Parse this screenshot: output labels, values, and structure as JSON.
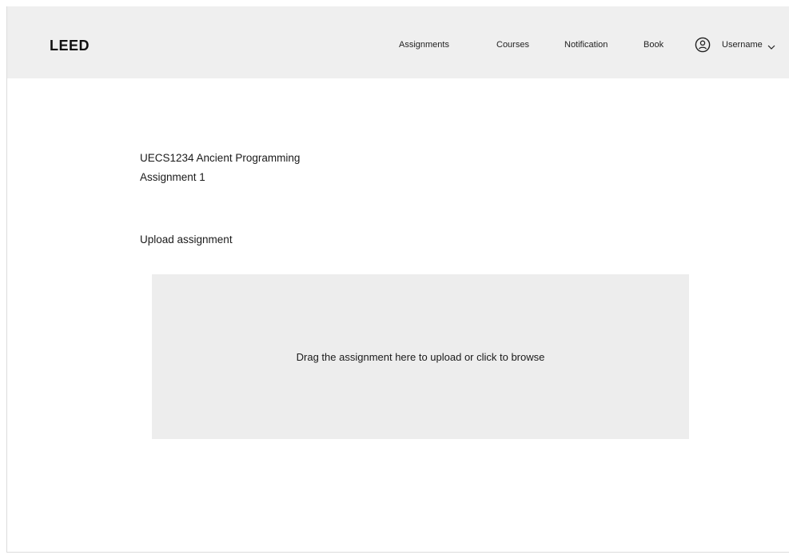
{
  "header": {
    "logo": "LEED",
    "nav": {
      "assignments": "Assignments",
      "courses": "Courses",
      "notification": "Notification",
      "book": "Book"
    },
    "user": {
      "label": "Username",
      "icon": "user-circle-icon",
      "dropdown_icon": "chevron-down-icon"
    },
    "background": "#efefef"
  },
  "main": {
    "course_title": "UECS1234 Ancient Programming",
    "assignment_title": "Assignment 1",
    "upload_heading": "Upload assignment",
    "dropzone": {
      "text": "Drag the assignment here to upload or click to browse",
      "background": "#ededed"
    }
  }
}
